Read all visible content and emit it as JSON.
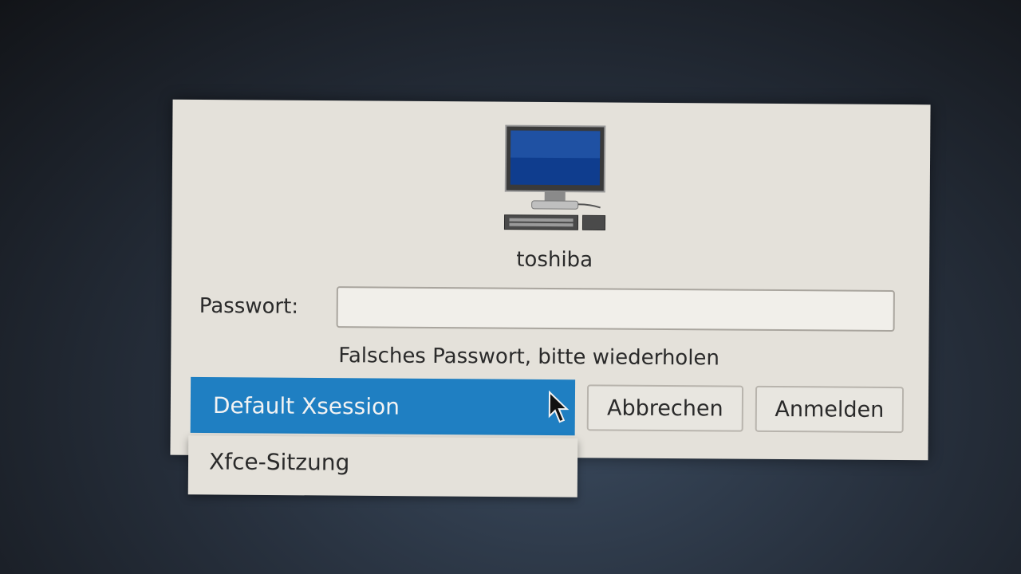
{
  "user": {
    "name": "toshiba"
  },
  "login": {
    "password_label": "Passwort:",
    "password_value": "",
    "error_message": "Falsches Passwort, bitte wiederholen"
  },
  "session": {
    "selected": "Default Xsession",
    "options": [
      "Xfce-Sitzung"
    ]
  },
  "buttons": {
    "cancel": "Abbrechen",
    "login": "Anmelden"
  },
  "icons": {
    "user_avatar": "computer-icon",
    "pointer": "mouse-cursor-icon"
  },
  "colors": {
    "selection": "#1f7fc2",
    "dialog_bg": "#e4e1da"
  }
}
